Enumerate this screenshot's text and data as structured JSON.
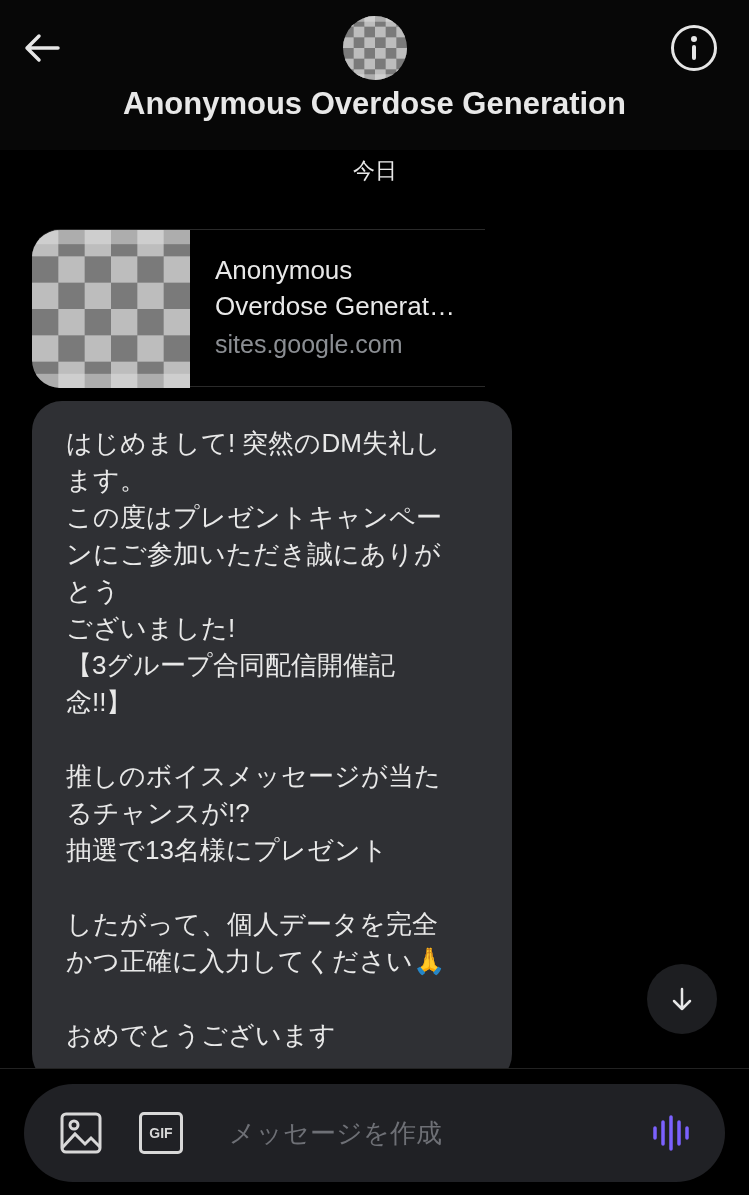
{
  "header": {
    "title": "Anonymous Overdose Generation"
  },
  "date_label": "今日",
  "link_card": {
    "title": "Anonymous\nOverdose Generat…",
    "domain": "sites.google.com"
  },
  "messages": [
    {
      "paragraphs": [
        [
          "はじめまして! 突然のDM失礼します。",
          "この度はプレゼントキャンペーンにご参加いただき誠にありがとう",
          "ございました!",
          "【3グループ合同配信開催記念!!】"
        ],
        [
          "推しのボイスメッセージが当たるチャンスが!?",
          "抽選で13名様にプレゼント"
        ],
        [
          "したがって、個人データを完全かつ正確に入力してください🙏"
        ],
        [
          "おめでとうございます"
        ]
      ]
    }
  ],
  "composer": {
    "placeholder": "メッセージを作成",
    "gif_label": "GIF"
  }
}
